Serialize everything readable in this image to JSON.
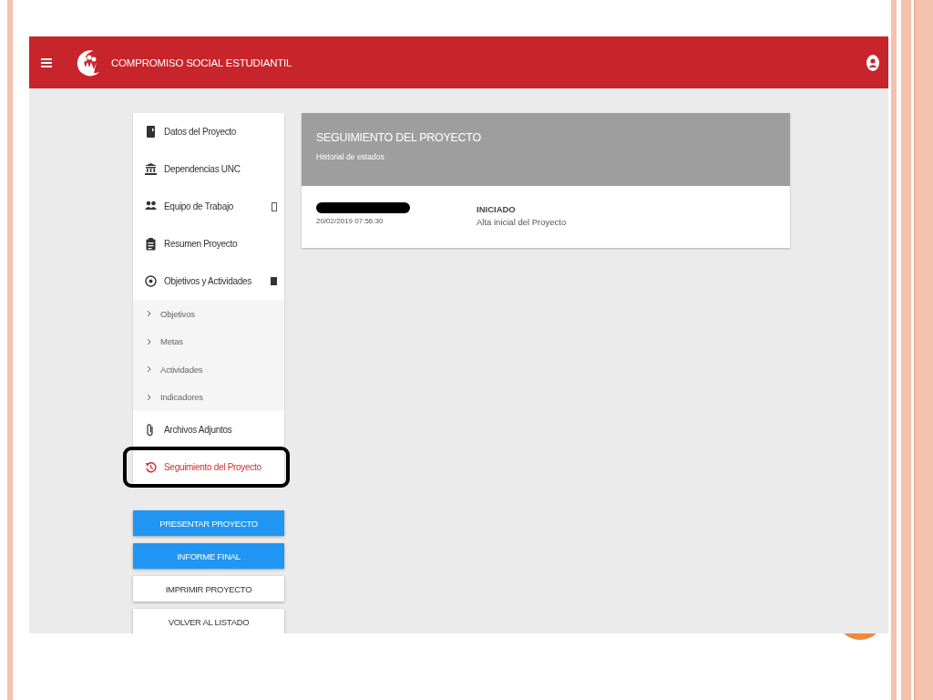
{
  "app_bar": {
    "title": "COMPROMISO SOCIAL ESTUDIANTIL"
  },
  "sidebar": {
    "items": [
      {
        "kind": "main",
        "label": "Datos del Proyecto",
        "selected": false
      },
      {
        "kind": "main",
        "label": "Dependencias UNC",
        "selected": false
      },
      {
        "kind": "main",
        "label": "Equipo de Trabajo",
        "selected": false
      },
      {
        "kind": "main",
        "label": "Resumen Proyecto",
        "selected": false
      },
      {
        "kind": "main",
        "label": "Objetivos y Actividades",
        "selected": false,
        "expanded": true,
        "children": [
          {
            "label": "Objetivos",
            "selected": false
          },
          {
            "label": "Metas",
            "selected": false
          },
          {
            "label": "Actividades",
            "selected": false
          },
          {
            "label": "Indicadores",
            "selected": false
          }
        ]
      },
      {
        "kind": "main",
        "label": "Archivos Adjuntos",
        "selected": false
      },
      {
        "kind": "main",
        "label": "Seguimiento del Proyecto",
        "selected": true,
        "highlighted": true
      }
    ]
  },
  "actions": [
    {
      "label": "PRESENTAR PROYECTO",
      "kind": "primary"
    },
    {
      "label": "INFORME FINAL",
      "kind": "primary"
    },
    {
      "label": "IMPRIMIR PROYECTO",
      "kind": "plain"
    },
    {
      "label": "VOLVER AL LISTADO",
      "kind": "plain"
    }
  ],
  "card": {
    "title": "SEGUIMIENTO DEL PROYECTO",
    "subtitle": "Historial de estados",
    "entries": [
      {
        "redacted": true,
        "timestamp": "20/02/2019 07:56:30",
        "state": "INICIADO",
        "description": "Alta inicial del Proyecto"
      }
    ]
  }
}
